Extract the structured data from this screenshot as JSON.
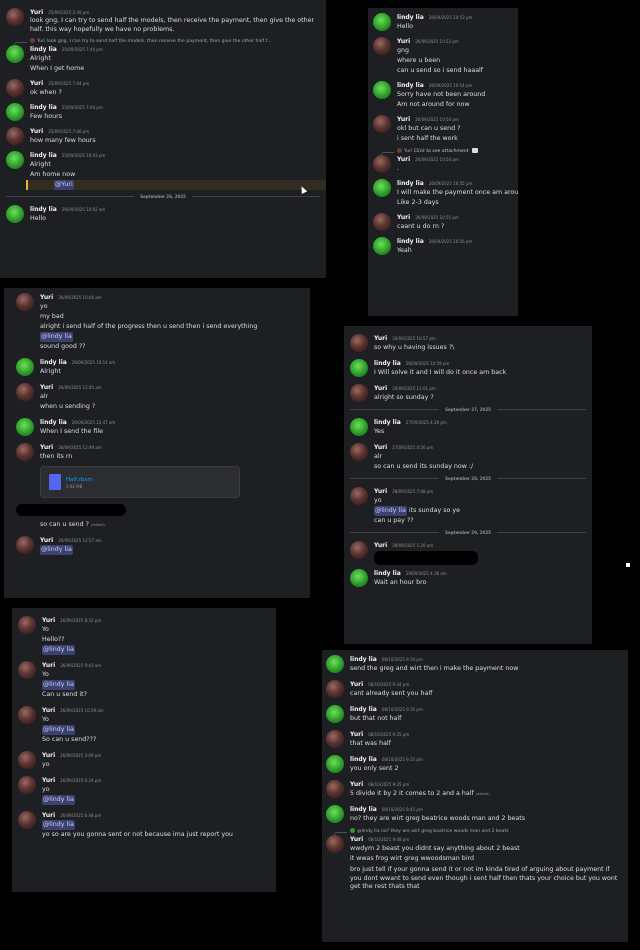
{
  "users": {
    "yuri": {
      "name": "Yuri"
    },
    "lindy": {
      "name": "lindy lia"
    }
  },
  "panel1": {
    "m1": {
      "user": "Yuri",
      "time": "25/09/2025 2:39 pm",
      "text": "look gng, I can try to send half the models, then receive the payment, then give the other half. this way hopefully we have no problems."
    },
    "reply": "Yuri look gng, I can try to send half the models, then receive the payment, then give the other half t...",
    "m2": {
      "user": "lindy lia",
      "time": "25/09/2025 7:44 pm",
      "l1": "Alright",
      "l2": "When I get home"
    },
    "m3": {
      "user": "Yuri",
      "time": "25/09/2025 7:44 pm",
      "text": "ok when ?"
    },
    "m4": {
      "user": "lindy lia",
      "time": "25/09/2025 7:44 pm",
      "text": "Few hours"
    },
    "m5": {
      "user": "Yuri",
      "time": "25/09/2025 7:46 pm",
      "text": "how many few hours"
    },
    "m6": {
      "user": "lindy lia",
      "time": "25/09/2025 10:03 pm",
      "l1": "Alright",
      "l2": "Am home now",
      "mention": "@Yuri"
    },
    "divider": "September 26, 2025",
    "m7": {
      "user": "lindy lia",
      "time": "26/09/2025 10:02 am",
      "text": "Hello"
    }
  },
  "panel2": {
    "m1": {
      "user": "Yuri",
      "time": "26/09/2025 10:04 am",
      "l1": "yo",
      "l2": "my bad",
      "l3": "alright i send half of the progress then u send then i send everything",
      "mention": "@lindy lia",
      "l4": "sound good ??"
    },
    "m2": {
      "user": "lindy lia",
      "time": "26/09/2025 10:14 am",
      "text": "Alright"
    },
    "m3": {
      "user": "Yuri",
      "time": "26/09/2025 12:45 am",
      "l1": "alr",
      "l2": "when u sending ?"
    },
    "m4": {
      "user": "lindy lia",
      "time": "26/09/2025 12:47 am",
      "text": "When I send the file"
    },
    "m5": {
      "user": "Yuri",
      "time": "26/09/2025 12:49 am",
      "text": "then its rn"
    },
    "file": {
      "name": "Half.rbxm",
      "size": "3.92 MB"
    },
    "l_send": "so can u send ?",
    "edited": "(edited)",
    "m6": {
      "user": "Yuri",
      "time": "26/09/2025 12:57 am",
      "mention": "@lindy lia"
    }
  },
  "panel3": {
    "m1": {
      "user": "Yuri",
      "time": "26/09/2025 8:32 pm",
      "l1": "Yo",
      "l2": "Hello??",
      "mention": "@lindy lia"
    },
    "m2": {
      "user": "Yuri",
      "time": "26/09/2025 9:43 am",
      "l1": "Yo",
      "mention": "@lindy lia",
      "l2": "Can u send it?"
    },
    "m3": {
      "user": "Yuri",
      "time": "26/09/2025 10:29 am",
      "l1": "Yo",
      "mention": "@lindy lia",
      "l2": "So can u send???"
    },
    "m4": {
      "user": "Yuri",
      "time": "26/09/2025 3:09 pm",
      "text": "yo"
    },
    "m5": {
      "user": "Yuri",
      "time": "26/09/2025 6:24 pm",
      "l1": "yo",
      "mention": "@lindy lia"
    },
    "m6": {
      "user": "Yuri",
      "time": "26/09/2025 6:48 pm",
      "mention": "@lindy lia",
      "l1": "yo so are you gonna sent or  not because ima just report you"
    }
  },
  "panel4": {
    "m1": {
      "user": "lindy lia",
      "time": "26/09/2025 10:53 pm",
      "text": "Hello"
    },
    "m2": {
      "user": "Yuri",
      "time": "26/09/2025 10:53 pm",
      "l1": "gng",
      "l2": "where u been",
      "l3": "can u send so i send haaalf"
    },
    "m3": {
      "user": "lindy lia",
      "time": "26/09/2025 10:54 pm",
      "l1": "Sorry have not been around",
      "l2": "Am not around for now"
    },
    "m4": {
      "user": "Yuri",
      "time": "26/09/2025 10:54 pm",
      "l1": "okl but can u send ?",
      "l2": "i sent half the work"
    },
    "reply": "Click to see attachment",
    "reply_user": "Yuri",
    "m5": {
      "user": "Yuri",
      "time": "26/09/2025 10:54 pm",
      "text": "."
    },
    "m6": {
      "user": "lindy lia",
      "time": "26/09/2025 10:55 pm",
      "l1": "I will make the payment once am around",
      "l2": "Like 2-3 days"
    },
    "m7": {
      "user": "Yuri",
      "time": "26/09/2025 10:55 pm",
      "text": "caant u do rn ?"
    },
    "m8": {
      "user": "lindy lia",
      "time": "26/09/2025 10:56 pm",
      "text": "Yeah"
    }
  },
  "panel5": {
    "m1": {
      "user": "Yuri",
      "time": "26/09/2025 10:57 pm",
      "text": "so why u having issues ?\\"
    },
    "m2": {
      "user": "lindy lia",
      "time": "26/09/2025 10:59 pm",
      "text": "I Will solve it and I will do it once am back"
    },
    "m3": {
      "user": "Yuri",
      "time": "26/09/2025 11:01 pm",
      "text": "alright so sunday ?"
    },
    "d1": "September 27, 2025",
    "m4": {
      "user": "lindy lia",
      "time": "27/09/2025 4:26 pm",
      "text": "Yes"
    },
    "m5": {
      "user": "Yuri",
      "time": "27/09/2025 4:26 pm",
      "l1": "alr",
      "l2": "so can u send its sunday now :/"
    },
    "d2": "September 28, 2025",
    "m6": {
      "user": "Yuri",
      "time": "28/09/2025 7:48 pm",
      "l1": "yo",
      "mention": "@lindy lia",
      "after": " its sunday so ye",
      "l2": "can u pay ??"
    },
    "d3": "September 29, 2025",
    "m7": {
      "user": "Yuri",
      "time": "29/09/2025 1:20 am"
    },
    "m8": {
      "user": "lindy lia",
      "time": "29/09/2025 4:36 am",
      "text": "Wait an hour bro"
    }
  },
  "panel6": {
    "m1": {
      "user": "lindy lia",
      "time": "08/10/2025 9:34 pm",
      "text": "send the greg and wirt then i make the payment  now"
    },
    "m2": {
      "user": "Yuri",
      "time": "08/10/2025 9:34 pm",
      "text": "cant already sent you half"
    },
    "m3": {
      "user": "lindy lia",
      "time": "08/10/2025 9:35 pm",
      "text": "but that not half"
    },
    "m4": {
      "user": "Yuri",
      "time": "08/10/2025 9:35 pm",
      "text": "that was half"
    },
    "m5": {
      "user": "lindy lia",
      "time": "08/10/2025 9:35 pm",
      "text": "you only sent 2"
    },
    "m6": {
      "user": "Yuri",
      "time": "08/10/2025 9:35 pm",
      "text": "5 divide it by 2 it comes to 2 and a half",
      "edited": "(edited)"
    },
    "m7": {
      "user": "lindy lia",
      "time": "08/10/2025 9:45 pm",
      "text": "no? they are wirt greg beatrice woods man and 2 beats"
    },
    "reply": "@lindy lia no? they are wirt greg beatrice woods man and 2 beats",
    "m8": {
      "user": "Yuri",
      "time": "08/10/2025 9:48 pm",
      "l1": "wwdym 2 beast you didnt say anything about 2 beast",
      "l2": "it wwas frog wirt greg wwoodsman bird",
      "l3": "bro just tell if your gonna send it or not im kinda tired of arguing about payment if you dont wwant to send even though i sent half then thats your choice but you wont get the rest thats that"
    }
  },
  "colors": {
    "bg": "#1e1f22",
    "page": "#000000",
    "mention_bg": "#3c4270",
    "mention_fg": "#c9cdfb",
    "link": "#00a8fc",
    "lindy_avatar": "#2c9b2a",
    "yuri_avatar": "#5a3330"
  }
}
